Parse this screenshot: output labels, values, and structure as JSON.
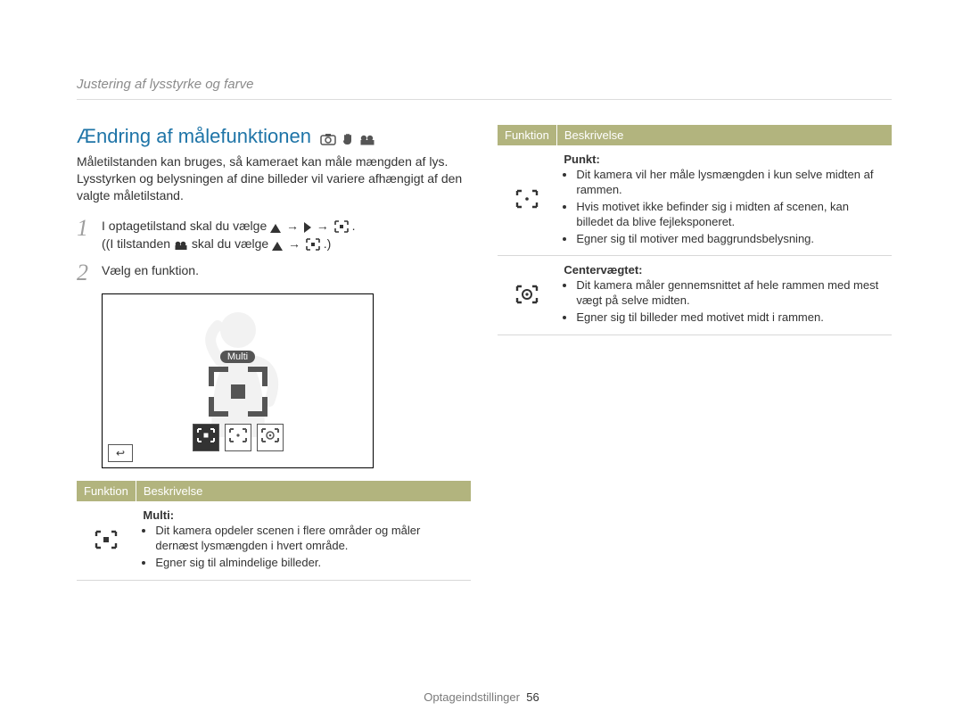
{
  "breadcrumb": "Justering af lysstyrke og farve",
  "section_title": "Ændring af målefunktionen",
  "intro": "Måletilstanden kan bruges, så kameraet kan måle mængden af lys. Lysstyrken og belysningen af dine billeder vil variere afhængigt af den valgte måletilstand.",
  "steps": {
    "s1_a": "I optagetilstand skal du vælge",
    "s1_b": "(I tilstanden",
    "s1_c": "skal du vælge",
    "s2": "Vælg en funktion."
  },
  "camera": {
    "multi_label": "Multi",
    "back_label": "↩"
  },
  "table_headers": {
    "funktion": "Funktion",
    "beskrivelse": "Beskrivelse"
  },
  "left_table": {
    "rows": [
      {
        "icon": "multi",
        "title": "Multi:",
        "bullets": [
          "Dit kamera opdeler scenen i flere områder og måler dernæst lysmængden i hvert område.",
          "Egner sig til almindelige billeder."
        ]
      }
    ]
  },
  "right_table": {
    "rows": [
      {
        "icon": "punkt",
        "title": "Punkt:",
        "bullets": [
          "Dit kamera vil her måle lysmængden i kun selve midten af rammen.",
          "Hvis motivet ikke befinder sig i midten af scenen, kan billedet da blive fejleksponeret.",
          "Egner sig til motiver med baggrundsbelysning."
        ]
      },
      {
        "icon": "center",
        "title": "Centervægtet:",
        "bullets": [
          "Dit kamera måler gennemsnittet af hele rammen med mest vægt på selve midten.",
          "Egner sig til billeder med motivet midt i rammen."
        ]
      }
    ]
  },
  "footer": {
    "label": "Optageindstillinger",
    "page": "56"
  },
  "colors": {
    "accent": "#1e74a7",
    "olive": "#b2b47e"
  }
}
